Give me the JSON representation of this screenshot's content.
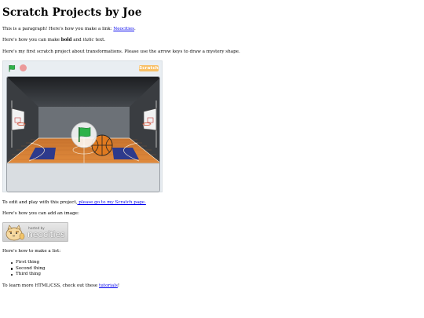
{
  "page": {
    "title": "Scratch Projects by Joe",
    "intro_text": "This is a paragraph! Here's how you make a link: ",
    "intro_link": "Neocities",
    "intro_end": ".",
    "bold_pre": "Here's how you can make ",
    "bold_word": "bold",
    "bold_mid": " and ",
    "italic_word": "italic",
    "bold_end": " text.",
    "project_text": "Here's my first scratch project about transformations. Please use the arrow keys to draw a mystery shape.",
    "edit_text": "To edit and play with this project,",
    "edit_link": " please go to my Scratch page.",
    "image_text": "Here's how you can add an image:",
    "list_text": "Here's how to make a list:",
    "list_items": [
      "First thing",
      "Second thing",
      "Third thing"
    ],
    "learn_pre": "To learn more HTML/CSS, check out these ",
    "learn_link": "tutorials",
    "learn_end": "!"
  },
  "player": {
    "logo_text": "Scratch",
    "icons": [
      "green-flag-icon",
      "stop-icon",
      "scratch-logo"
    ]
  },
  "badge": {
    "hosted_by": "hosted by",
    "name": "neocities"
  },
  "colors": {
    "link": "#0000ee",
    "court": "#d9823a",
    "paint": "#2d3a8c",
    "flag": "#27a744"
  }
}
